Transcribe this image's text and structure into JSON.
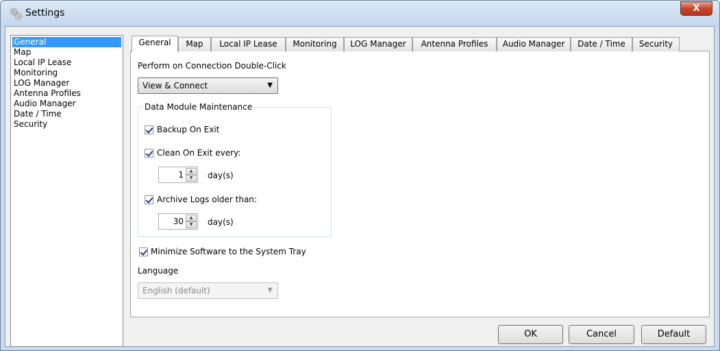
{
  "window": {
    "title": "Settings",
    "close_label": "X"
  },
  "nav": {
    "items": [
      {
        "label": "General",
        "selected": true
      },
      {
        "label": "Map"
      },
      {
        "label": "Local IP Lease"
      },
      {
        "label": "Monitoring"
      },
      {
        "label": "LOG Manager"
      },
      {
        "label": "Antenna Profiles"
      },
      {
        "label": "Audio Manager"
      },
      {
        "label": "Date / Time"
      },
      {
        "label": "Security"
      }
    ]
  },
  "tabs": [
    {
      "label": "General",
      "active": true
    },
    {
      "label": "Map"
    },
    {
      "label": "Local IP Lease"
    },
    {
      "label": "Monitoring"
    },
    {
      "label": "LOG Manager"
    },
    {
      "label": "Antenna Profiles"
    },
    {
      "label": "Audio Manager"
    },
    {
      "label": "Date / Time"
    },
    {
      "label": "Security"
    }
  ],
  "general": {
    "double_click_label": "Perform on Connection Double-Click",
    "double_click_value": "View & Connect",
    "maintenance_group": "Data Module Maintenance",
    "backup_label": "Backup On Exit",
    "backup_checked": true,
    "clean_label": "Clean On Exit every:",
    "clean_checked": true,
    "clean_days": "1",
    "days_unit": "day(s)",
    "archive_label": "Archive Logs older than:",
    "archive_checked": true,
    "archive_days": "30",
    "minimize_label": "Minimize Software to the System Tray",
    "minimize_checked": true,
    "language_label": "Language",
    "language_value": "English (default)"
  },
  "buttons": {
    "ok": "OK",
    "cancel": "Cancel",
    "default": "Default"
  },
  "colors": {
    "selection": "#3399ff",
    "window_frame": "#c9dbef",
    "close": "#c7462f"
  }
}
